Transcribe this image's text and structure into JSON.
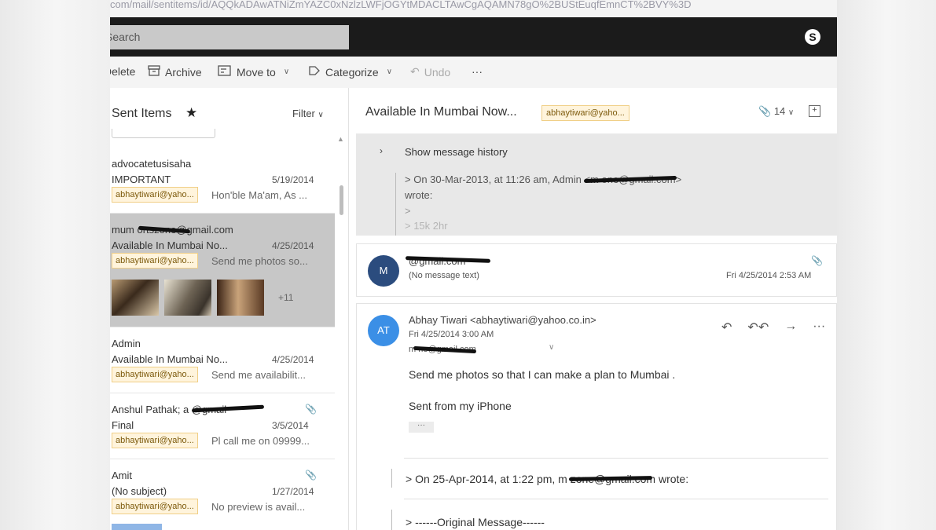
{
  "browser": {
    "url_text": "com/mail/sentitems/id/AQQkADAwATNiZmYAZC0xNzlzLWFjOGYtMDACLTAwCgAQAMN78gO%2BUStEuqfEmnCT%2BVY%3D"
  },
  "topbar": {
    "search_placeholder": "Search",
    "skype_icon": "skype-icon",
    "skype_glyph": "S"
  },
  "toolbar": {
    "delete_label": "Delete",
    "archive_label": "Archive",
    "move_to_label": "Move to",
    "categorize_label": "Categorize",
    "undo_label": "Undo",
    "more_label": "···"
  },
  "folder": {
    "title": "Sent Items",
    "star": "★",
    "filter_label": "Filter"
  },
  "messages": [
    {
      "sender": "advocatetusisaha",
      "subject": "IMPORTANT",
      "date": "5/19/2014",
      "tag": "abhaytiwari@yaho...",
      "preview": "Hon'ble Ma'am, As ..."
    },
    {
      "sender": "mum                      ortszone@gmail.com",
      "subject": "Available In Mumbai No...",
      "date": "4/25/2014",
      "tag": "abhaytiwari@yaho...",
      "preview": "Send me photos so...",
      "more_images": "+11"
    },
    {
      "sender": "Admin",
      "subject": "Available In Mumbai No...",
      "date": "4/25/2014",
      "tag": "abhaytiwari@yaho...",
      "preview": "Send me availabilit..."
    },
    {
      "sender": "Anshul Pathak; a                      @gmail",
      "subject": "Final",
      "date": "3/5/2014",
      "tag": "abhaytiwari@yaho...",
      "preview": "Pl call me on 09999..."
    },
    {
      "sender": "Amit",
      "subject": "(No subject)",
      "date": "1/27/2014",
      "tag": "abhaytiwari@yaho...",
      "preview": "No preview is avail..."
    }
  ],
  "conversation": {
    "title": "Available In Mumbai Now...",
    "tag": "abhaytiwari@yaho...",
    "attachment_count": "14",
    "history": {
      "label": "Show message history",
      "line1": "> On 30-Mar-2013, at 11:26 am, Admin <m                          one@gmail.com>",
      "line2": "wrote:",
      "line3": ">",
      "line4": "> 15k 2hr"
    },
    "card1": {
      "avatar": "M",
      "from": "                          @gmail.com",
      "preview": "(No message text)",
      "date": "Fri 4/25/2014 2:53 AM"
    },
    "card2": {
      "avatar": "AT",
      "from": "Abhay Tiwari <abhaytiwari@yahoo.co.in>",
      "date": "Fri 4/25/2014 3:00 AM",
      "to": "m                       ne@gmail.com",
      "body1": "Send me photos so that I can make a plan to Mumbai .",
      "body2": "Sent from my iPhone",
      "more": "···",
      "quote1": "> On 25-Apr-2014, at 1:22 pm, m                          zone@gmail.com wrote:",
      "quote2": "> ------Original Message------"
    }
  },
  "colors": {
    "topbar": "#1b1b1b",
    "selected_row": "#c7c7c7",
    "tag_bg": "#fff4dc",
    "avatar_m": "#2b4c7e",
    "avatar_at": "#3b8fe6"
  }
}
